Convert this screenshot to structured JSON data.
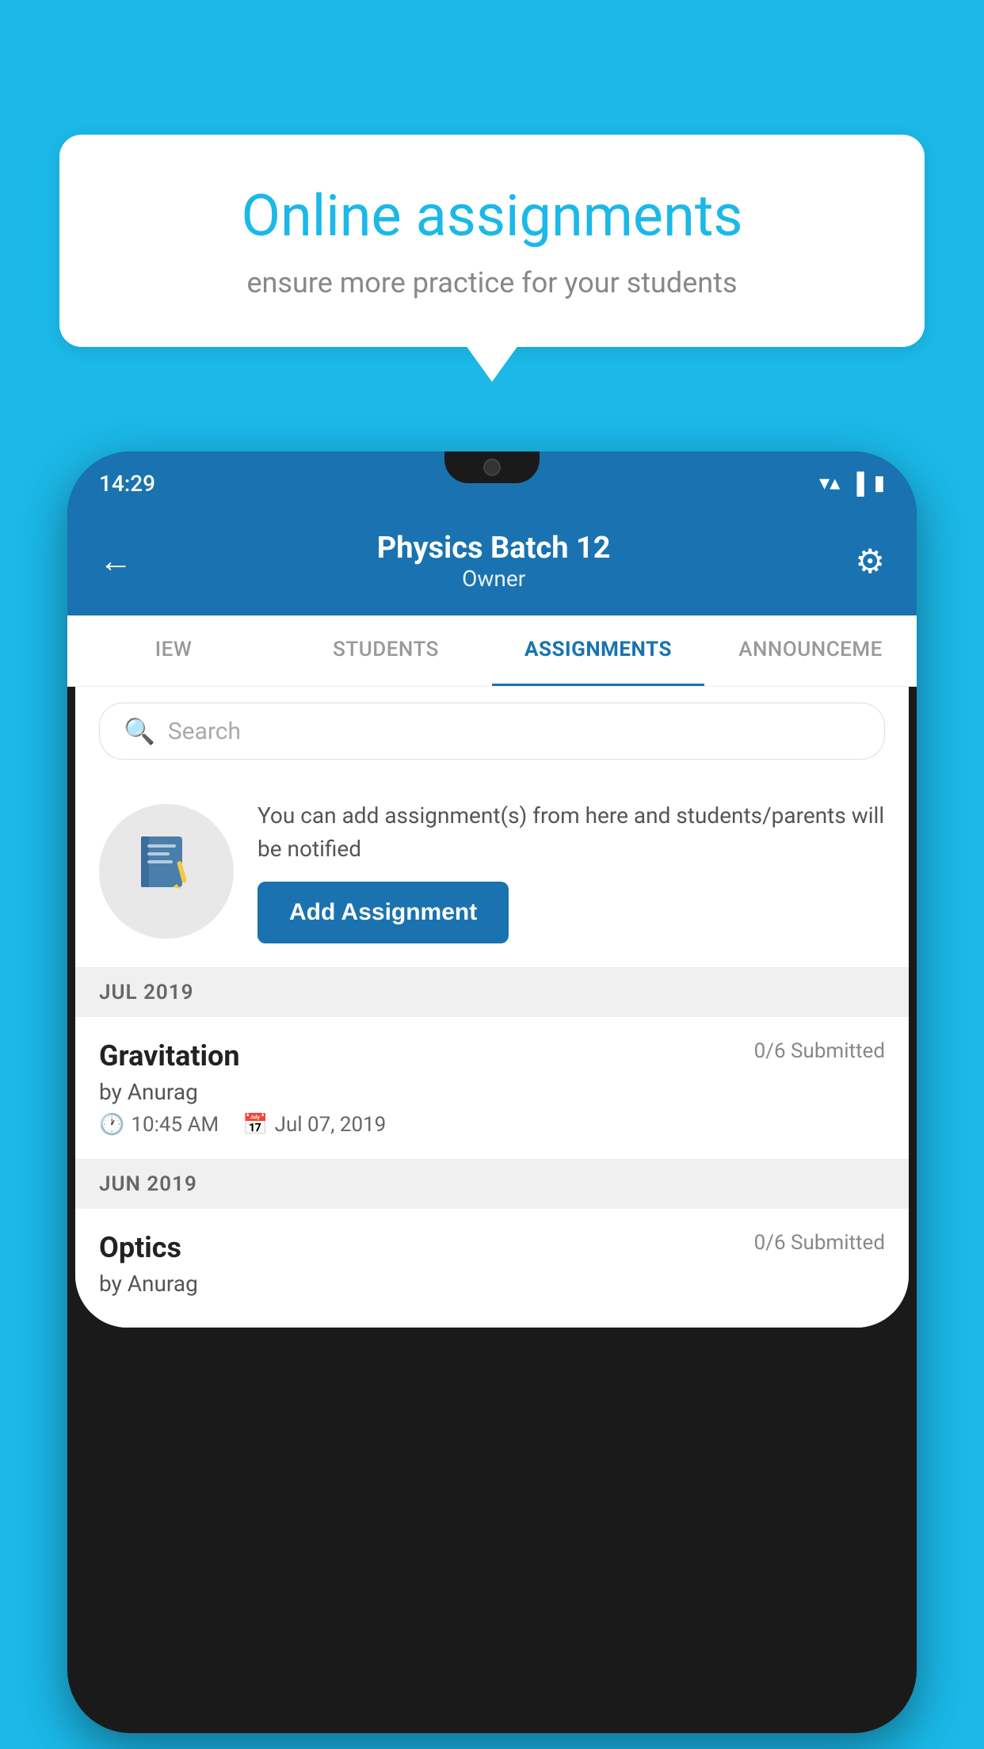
{
  "background_color": "#1bb8e8",
  "speech_bubble": {
    "title": "Online assignments",
    "subtitle": "ensure more practice for your students"
  },
  "phone": {
    "status_bar": {
      "time": "14:29",
      "icons": [
        "wifi",
        "signal",
        "battery"
      ]
    },
    "header": {
      "title": "Physics Batch 12",
      "subtitle": "Owner",
      "back_label": "←",
      "settings_label": "⚙"
    },
    "tabs": [
      {
        "label": "IEW",
        "active": false
      },
      {
        "label": "STUDENTS",
        "active": false
      },
      {
        "label": "ASSIGNMENTS",
        "active": true
      },
      {
        "label": "ANNOUNCEME",
        "active": false
      }
    ],
    "search": {
      "placeholder": "Search"
    },
    "add_section": {
      "description": "You can add assignment(s) from here and students/parents will be notified",
      "button_label": "Add Assignment"
    },
    "sections": [
      {
        "month_label": "JUL 2019",
        "assignments": [
          {
            "name": "Gravitation",
            "submitted": "0/6 Submitted",
            "by": "by Anurag",
            "time": "10:45 AM",
            "date": "Jul 07, 2019"
          }
        ]
      },
      {
        "month_label": "JUN 2019",
        "assignments": [
          {
            "name": "Optics",
            "submitted": "0/6 Submitted",
            "by": "by Anurag",
            "time": "",
            "date": ""
          }
        ]
      }
    ]
  }
}
